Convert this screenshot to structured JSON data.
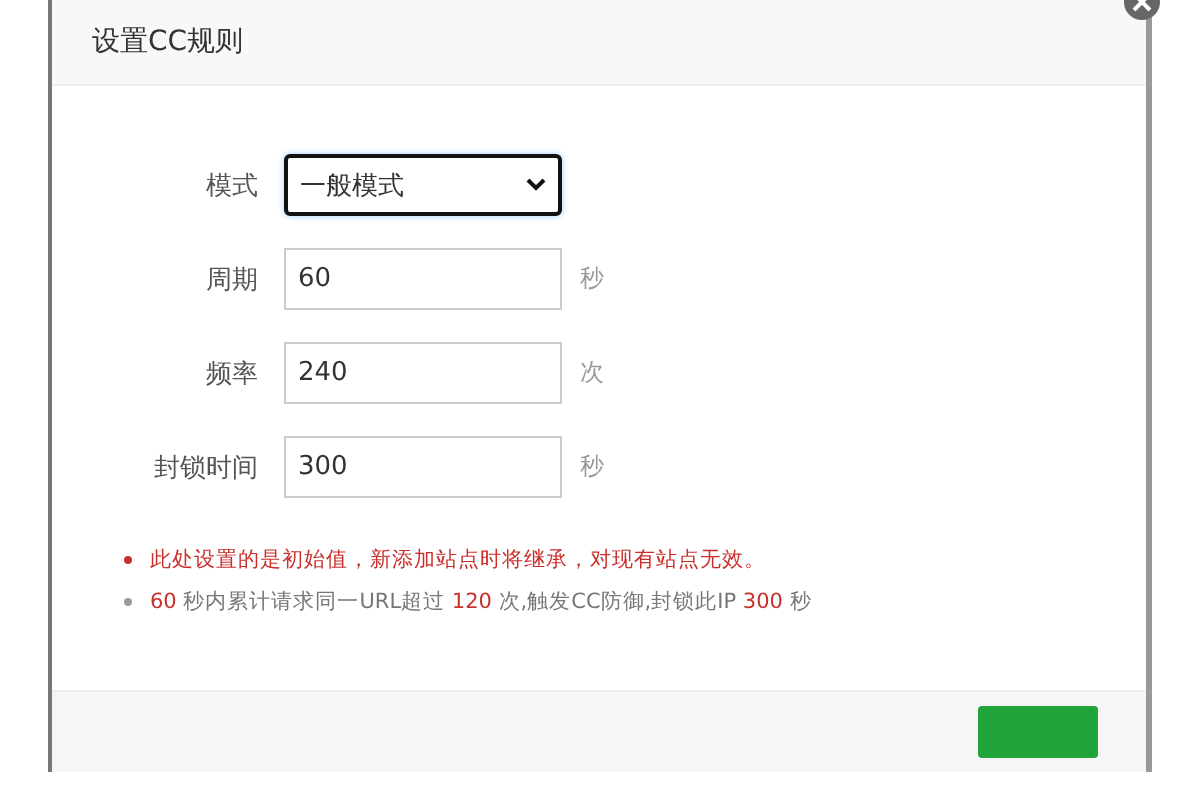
{
  "dialog": {
    "title": "设置CC规则"
  },
  "fields": [
    {
      "kind": "select",
      "label": "模式",
      "value": "一般模式",
      "focused": true
    },
    {
      "kind": "text",
      "label": "周期",
      "value": "60",
      "unit": "秒",
      "focused": false
    },
    {
      "kind": "text",
      "label": "频率",
      "value": "240",
      "unit": "次",
      "focused": false
    },
    {
      "kind": "text",
      "label": "封锁时间",
      "value": "300",
      "unit": "秒",
      "focused": false
    }
  ],
  "notes": [
    {
      "kind": "warning",
      "text": "此处设置的是初始值，新添加站点时将继承，对现有站点无效。"
    },
    {
      "kind": "info",
      "parts": [
        {
          "text": "60",
          "highlight": true
        },
        {
          "text": " 秒内累计请求同一URL超过 ",
          "highlight": false
        },
        {
          "text": "120",
          "highlight": true
        },
        {
          "text": " 次,触发CC防御,封锁此IP ",
          "highlight": false
        },
        {
          "text": "300",
          "highlight": true
        },
        {
          "text": " 秒",
          "highlight": false
        }
      ]
    }
  ]
}
